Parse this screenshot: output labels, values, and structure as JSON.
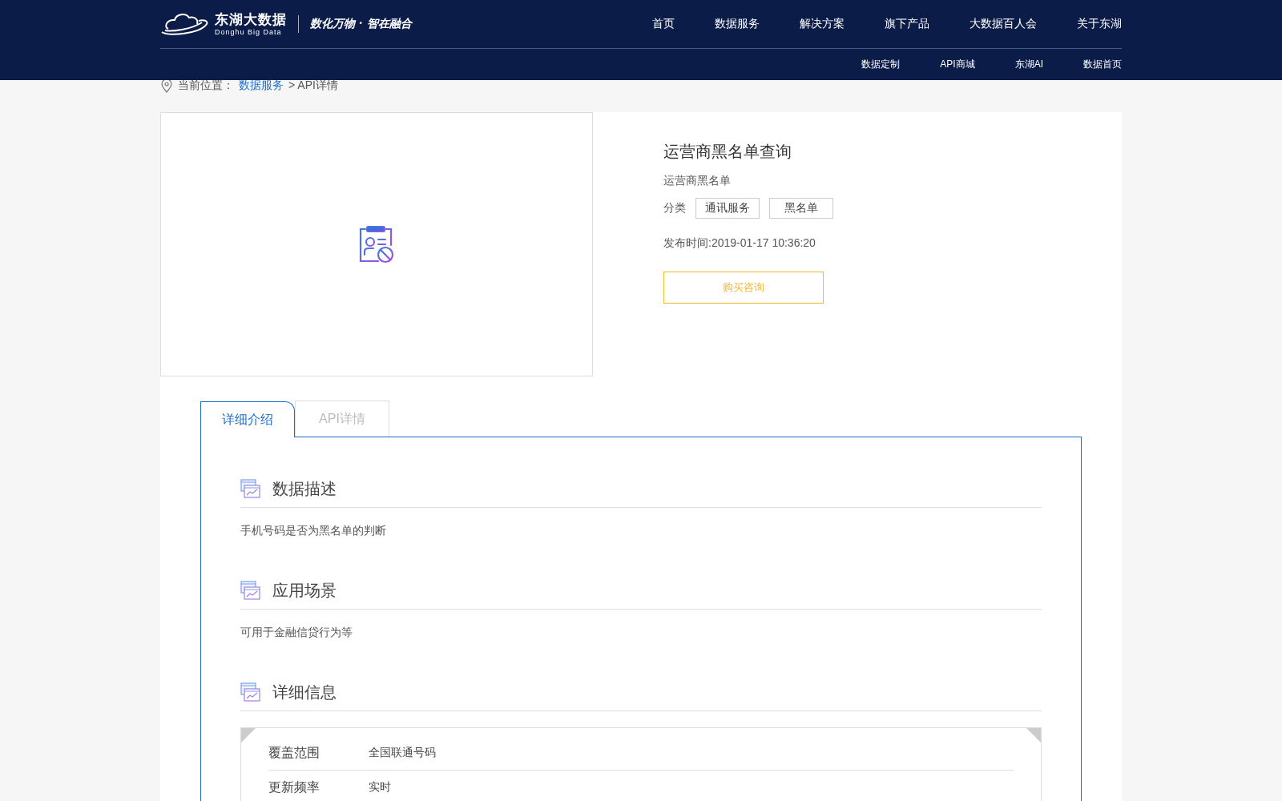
{
  "header": {
    "logo": {
      "name": "东湖大数据",
      "subtitle": "Donghu Big Data",
      "slogan": "数化万物 · 智在融合"
    },
    "nav": [
      {
        "label": "首页"
      },
      {
        "label": "数据服务"
      },
      {
        "label": "解决方案"
      },
      {
        "label": "旗下产品"
      },
      {
        "label": "大数据百人会"
      },
      {
        "label": "关于东湖"
      }
    ],
    "subnav": [
      {
        "label": "数据定制"
      },
      {
        "label": "API商城"
      },
      {
        "label": "东湖AI"
      },
      {
        "label": "数据首页"
      }
    ]
  },
  "breadcrumb": {
    "prefix": "当前位置：",
    "link": "数据服务",
    "current": "> API详情"
  },
  "product": {
    "title": "运营商黑名单查询",
    "subtitle": "运营商黑名单",
    "category_label": "分类",
    "tags": [
      "通讯服务",
      "黑名单"
    ],
    "published": "发布时间:2019-01-17 10:36:20",
    "button": "购买咨询"
  },
  "tabs": [
    {
      "label": "详细介绍",
      "selected": true
    },
    {
      "label": "API详情",
      "selected": false
    }
  ],
  "sections": [
    {
      "title": "数据描述",
      "text": "手机号码是否为黑名单的判断"
    },
    {
      "title": "应用场景",
      "text": "可用于金融信贷行为等"
    },
    {
      "title": "详细信息",
      "rows": [
        {
          "label": "覆盖范围",
          "value": "全国联通号码"
        },
        {
          "label": "更新频率",
          "value": "实时"
        }
      ]
    }
  ]
}
